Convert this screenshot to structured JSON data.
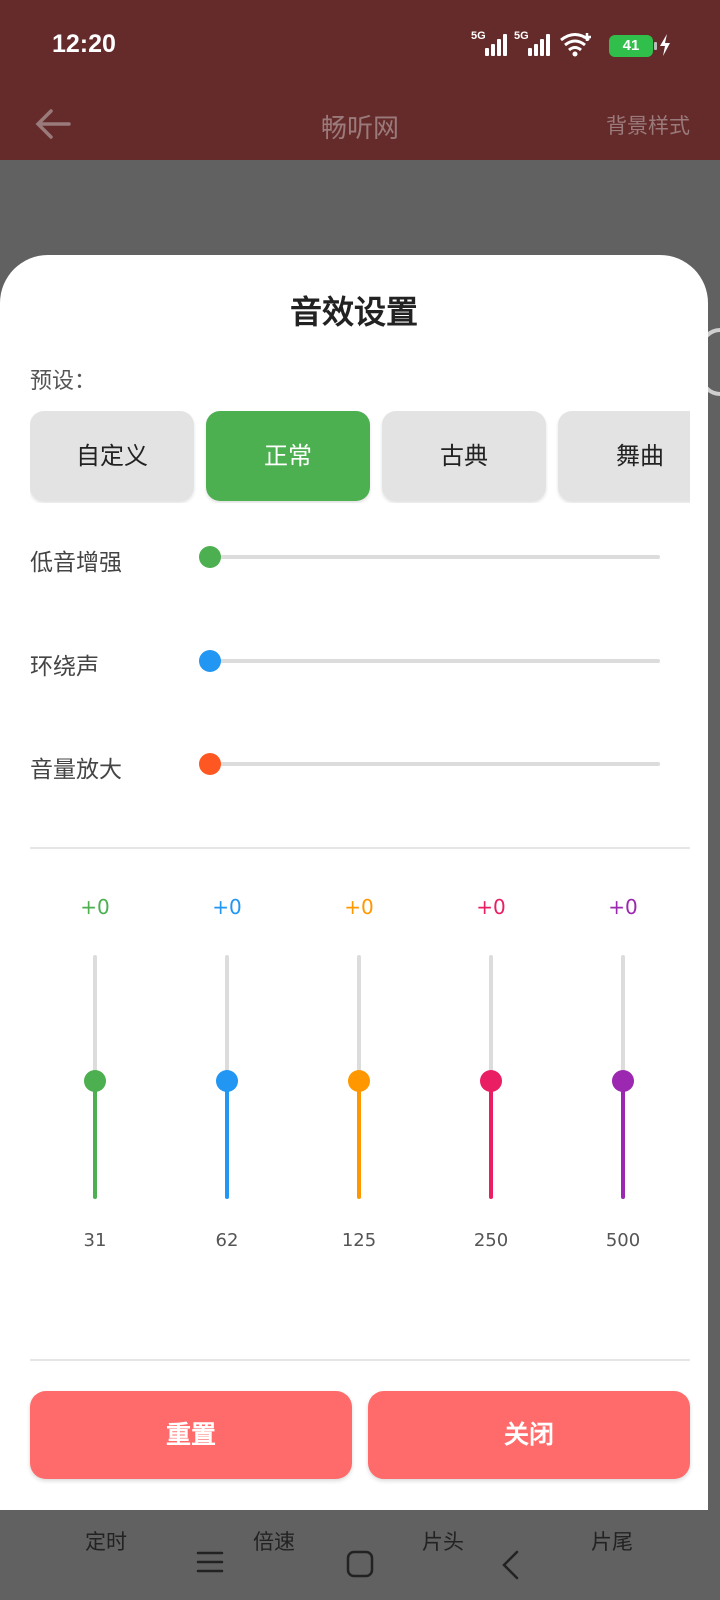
{
  "status": {
    "time": "12:20",
    "signal1_label": "5G",
    "signal2_label": "5G",
    "wifi_icon": "wifi-6-icon",
    "battery": "41",
    "charging_icon": "bolt-icon"
  },
  "appbar": {
    "back_icon": "arrow-left-icon",
    "title": "畅听网",
    "action": "背景样式"
  },
  "sheet": {
    "title": "音效设置",
    "preset_label": "预设：",
    "presets": [
      {
        "label": "自定义",
        "active": false
      },
      {
        "label": "正常",
        "active": true
      },
      {
        "label": "古典",
        "active": false
      },
      {
        "label": "舞曲",
        "active": false
      }
    ],
    "sliders": [
      {
        "label": "低音增强",
        "value": 0,
        "color": "#4caf50"
      },
      {
        "label": "环绕声",
        "value": 0,
        "color": "#2196f3"
      },
      {
        "label": "音量放大",
        "value": 0,
        "color": "#ff5722"
      }
    ],
    "equalizer": [
      {
        "gain": "+0",
        "freq": "31",
        "color": "#4caf50"
      },
      {
        "gain": "+0",
        "freq": "62",
        "color": "#2196f3"
      },
      {
        "gain": "+0",
        "freq": "125",
        "color": "#ff9800"
      },
      {
        "gain": "+0",
        "freq": "250",
        "color": "#e91e63"
      },
      {
        "gain": "+0",
        "freq": "500",
        "color": "#9c27b0"
      }
    ],
    "reset_label": "重置",
    "close_label": "关闭"
  },
  "bottom_bar": {
    "items": [
      "定时",
      "倍速",
      "片头",
      "片尾"
    ],
    "nav_icons": [
      "menu-icon",
      "home-square-icon",
      "back-chevron-icon"
    ]
  },
  "colors": {
    "header": "#652b2b",
    "accent": "#4caf50",
    "button": "#ff6b6b"
  }
}
